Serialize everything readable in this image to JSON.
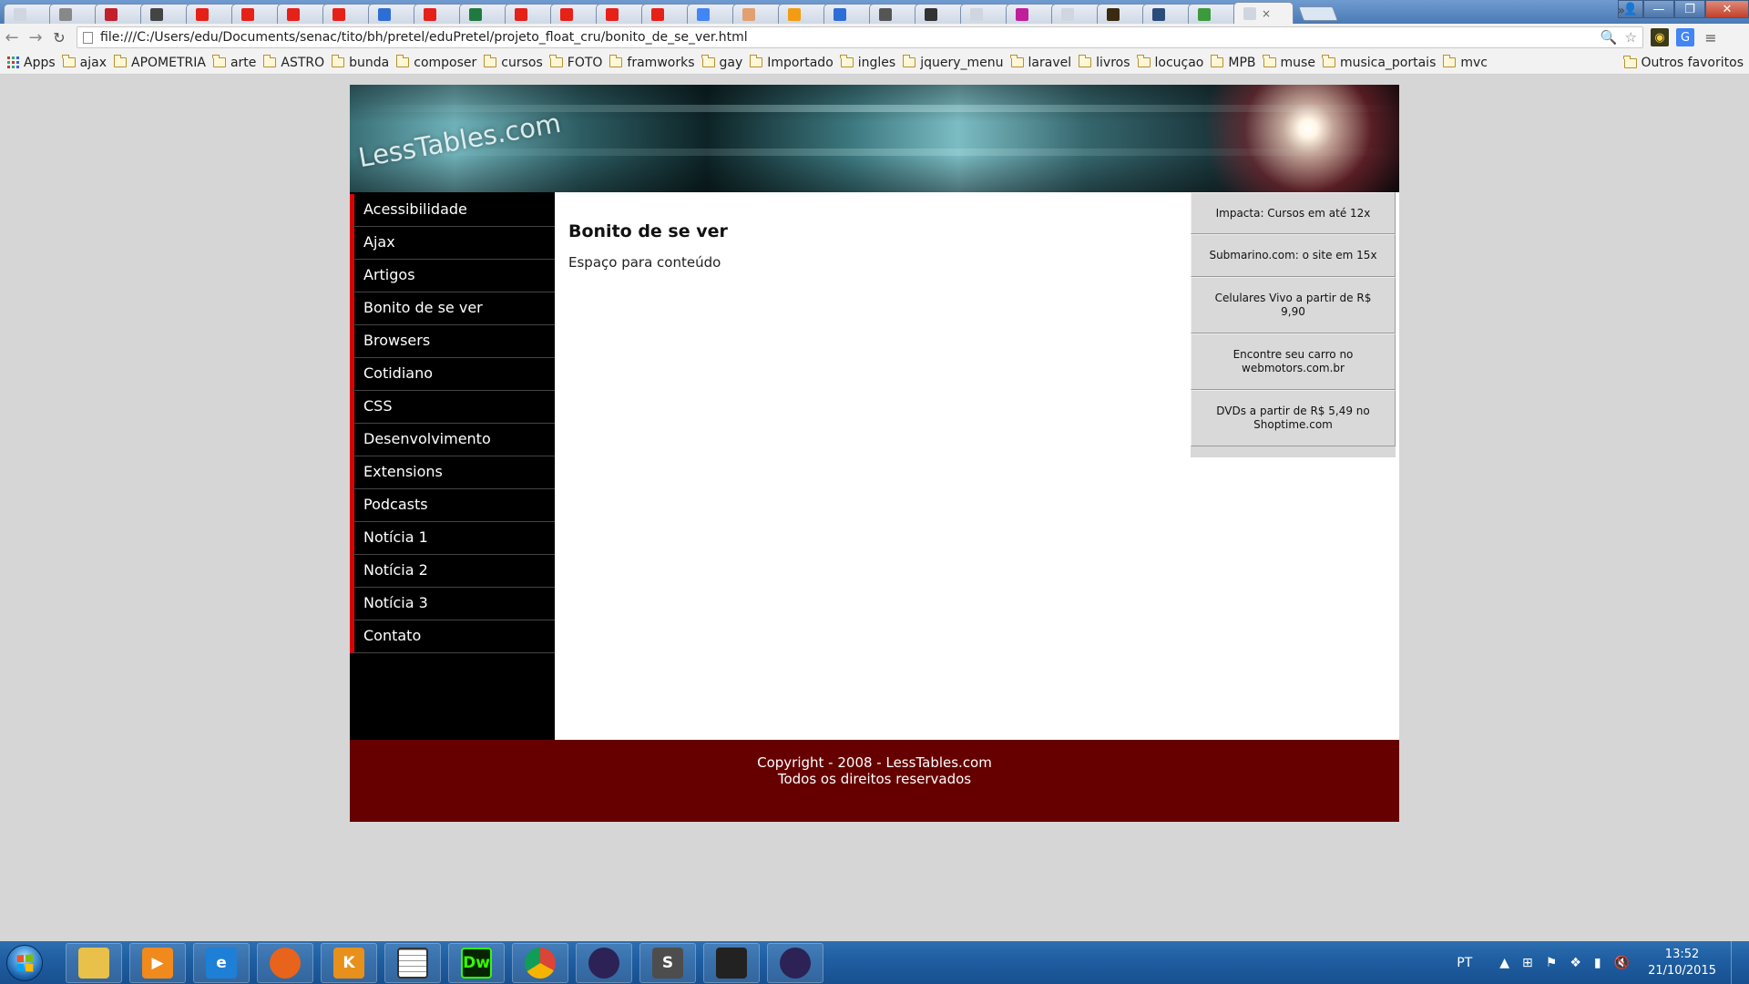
{
  "browser": {
    "tabs": [
      {
        "fav_color": "#cfd6df"
      },
      {
        "fav_color": "#888888"
      },
      {
        "fav_color": "#c4202a"
      },
      {
        "fav_color": "#444444"
      },
      {
        "fav_color": "#e62117"
      },
      {
        "fav_color": "#e62117"
      },
      {
        "fav_color": "#e62117"
      },
      {
        "fav_color": "#e62117"
      },
      {
        "fav_color": "#2d6dd6"
      },
      {
        "fav_color": "#e62117"
      },
      {
        "fav_color": "#1f7a3f"
      },
      {
        "fav_color": "#e62117"
      },
      {
        "fav_color": "#e62117"
      },
      {
        "fav_color": "#e62117"
      },
      {
        "fav_color": "#e62117"
      },
      {
        "fav_color": "#4285f4"
      },
      {
        "fav_color": "#e0a070"
      },
      {
        "fav_color": "#f39c12"
      },
      {
        "fav_color": "#2d6dd6"
      },
      {
        "fav_color": "#555555"
      },
      {
        "fav_color": "#333333"
      },
      {
        "fav_color": "#cfd6df"
      },
      {
        "fav_color": "#c01f9b"
      },
      {
        "fav_color": "#cfd6df"
      },
      {
        "fav_color": "#3a2a10"
      },
      {
        "fav_color": "#2b4b7a"
      },
      {
        "fav_color": "#3c9a3c"
      },
      {
        "fav_color": "#cfd6df"
      }
    ],
    "active_tab_close": "×",
    "address": "file:///C:/Users/edu/Documents/senac/tito/bh/pretel/eduPretel/projeto_float_cru/bonito_de_se_ver.html",
    "bookmarks": [
      "ajax",
      "APOMETRIA",
      "arte",
      "ASTRO",
      "bunda",
      "composer",
      "cursos",
      "FOTO",
      "framworks",
      "gay",
      "Importado",
      "ingles",
      "jquery_menu",
      "laravel",
      "livros",
      "locuçao",
      "MPB",
      "muse",
      "musica_portais",
      "mvc"
    ],
    "apps_label": "Apps",
    "more_label": "»",
    "other_bookmarks_label": "Outros favoritos"
  },
  "site": {
    "logo": "LessTables.com",
    "menu": [
      "Acessibilidade",
      "Ajax",
      "Artigos",
      "Bonito de se ver",
      "Browsers",
      "Cotidiano",
      "CSS",
      "Desenvolvimento",
      "Extensions",
      "Podcasts",
      "Notícia 1",
      "Notícia 2",
      "Notícia 3",
      "Contato"
    ],
    "content": {
      "title": "Bonito de se ver",
      "text": "Espaço para conteúdo"
    },
    "ads": [
      "Impacta: Cursos em até 12x",
      "Submarino.com: o site em 15x",
      "Celulares Vivo a partir de R$ 9,90",
      "Encontre seu carro no webmotors.com.br",
      "DVDs a partir de R$ 5,49 no Shoptime.com"
    ],
    "footer": {
      "line1": "Copyright - 2008 - LessTables.com",
      "line2": "Todos os direitos reservados"
    },
    "colors": {
      "footer_bg": "#660000",
      "sidebar_bg": "#000000",
      "menu_accent": "#dd0000"
    }
  },
  "taskbar": {
    "apps": [
      {
        "name": "explorer",
        "icon": "folder-icon",
        "color": "#e8c04a",
        "glyph": ""
      },
      {
        "name": "media-player",
        "icon": "media-player-icon",
        "color": "#f08a1c",
        "glyph": "▶"
      },
      {
        "name": "internet-explorer",
        "icon": "ie-icon",
        "color": "#1d7fd6",
        "glyph": "e"
      },
      {
        "name": "firefox",
        "icon": "firefox-icon",
        "color": "#e8631c",
        "glyph": ""
      },
      {
        "name": "klite",
        "icon": "klite-icon",
        "color": "#e8901c",
        "glyph": "K"
      },
      {
        "name": "calendar",
        "icon": "calendar-icon",
        "color": "#ffffff",
        "glyph": ""
      },
      {
        "name": "dreamweaver",
        "icon": "dreamweaver-icon",
        "color": "#35fa00",
        "glyph": "Dw"
      },
      {
        "name": "chrome",
        "icon": "chrome-icon",
        "color": "#4285f4",
        "glyph": ""
      },
      {
        "name": "eclipse",
        "icon": "eclipse-icon",
        "color": "#2c2255",
        "glyph": ""
      },
      {
        "name": "sublime",
        "icon": "sublime-icon",
        "color": "#4d4d4d",
        "glyph": "S"
      },
      {
        "name": "network",
        "icon": "satellite-icon",
        "color": "#222222",
        "glyph": ""
      },
      {
        "name": "eclipse-2",
        "icon": "eclipse-icon",
        "color": "#2c2255",
        "glyph": ""
      }
    ],
    "language": "PT",
    "time": "13:52",
    "date": "21/10/2015"
  }
}
